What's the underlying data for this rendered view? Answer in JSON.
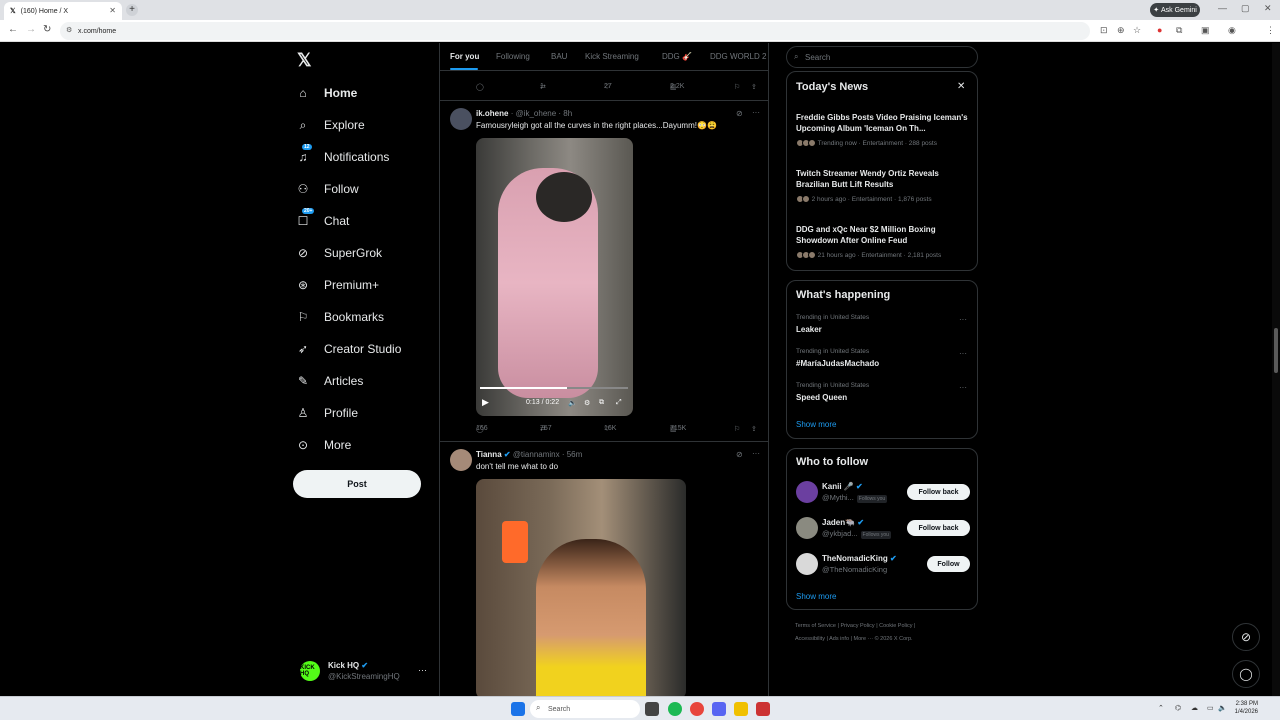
{
  "browser": {
    "tab_title": "(160) Home / X",
    "url": "x.com/home",
    "gemini_label": "Ask Gemini"
  },
  "sidebar": {
    "items": [
      {
        "label": "Home",
        "icon": "home-icon"
      },
      {
        "label": "Explore",
        "icon": "search-icon"
      },
      {
        "label": "Notifications",
        "icon": "bell-icon",
        "badge": "12"
      },
      {
        "label": "Follow",
        "icon": "person-plus-icon"
      },
      {
        "label": "Chat",
        "icon": "chat-icon",
        "badge": "20+"
      },
      {
        "label": "SuperGrok",
        "icon": "grok-icon"
      },
      {
        "label": "Premium+",
        "icon": "x-check-icon"
      },
      {
        "label": "Bookmarks",
        "icon": "bookmark-icon"
      },
      {
        "label": "Creator Studio",
        "icon": "rocket-icon"
      },
      {
        "label": "Articles",
        "icon": "article-icon"
      },
      {
        "label": "Profile",
        "icon": "person-icon"
      },
      {
        "label": "More",
        "icon": "more-circle-icon"
      }
    ],
    "post_label": "Post",
    "account": {
      "name": "Kick HQ",
      "handle": "@KickStreamingHQ",
      "avatar_text": "KICK HQ"
    }
  },
  "feed": {
    "tabs": [
      "For you",
      "Following",
      "BAU",
      "Kick Streaming",
      "DDG 🎸",
      "DDG WORLD 2"
    ],
    "prev_actions": {
      "replies": "",
      "reposts": "1",
      "likes": "27",
      "views": "2.2K"
    },
    "posts": [
      {
        "name": "ik.ohene",
        "handle": "@ik_ohene",
        "time": "8h",
        "text": "Famousryleigh got all the curves in the right places...Dayumm!😳😩",
        "video_time": "0:13 / 0:22",
        "video_progress": 0.59,
        "replies": "166",
        "reposts": "757",
        "likes": "16K",
        "views": "715K"
      },
      {
        "name": "Tianna",
        "handle": "@tiannaminx",
        "time": "56m",
        "text": "don't tell me what to do"
      }
    ]
  },
  "right": {
    "search_placeholder": "Search",
    "news": {
      "title": "Today's News",
      "items": [
        {
          "title": "Freddie Gibbs Posts Video Praising Iceman's Upcoming Album 'Iceman On Th...",
          "meta": "Trending now · Entertainment · 288 posts"
        },
        {
          "title": "Twitch Streamer Wendy Ortiz Reveals Brazilian Butt Lift Results",
          "meta": "2 hours ago · Entertainment · 1,876 posts"
        },
        {
          "title": "DDG and xQc Near $2 Million Boxing Showdown After Online Feud",
          "meta": "21 hours ago · Entertainment · 2,181 posts"
        }
      ]
    },
    "happening": {
      "title": "What's happening",
      "items": [
        {
          "context": "Trending in United States",
          "name": "Leaker"
        },
        {
          "context": "Trending in United States",
          "name": "#MaríaJudasMachado"
        },
        {
          "context": "Trending in United States",
          "name": "Speed Queen"
        }
      ],
      "show_more": "Show more"
    },
    "who_to_follow": {
      "title": "Who to follow",
      "items": [
        {
          "name": "Kanii 🎤",
          "handle": "@Mythi...",
          "follows_you": "Follows you",
          "button": "Follow back"
        },
        {
          "name": "Jaden🐃",
          "handle": "@ykbjad...",
          "follows_you": "Follows you",
          "button": "Follow back"
        },
        {
          "name": "TheNomadicKing",
          "handle": "@TheNomadicKing",
          "follows_you": "",
          "button": "Follow"
        }
      ],
      "show_more": "Show more"
    },
    "footer_line1": "Terms of Service  |  Privacy Policy  |  Cookie Policy  |",
    "footer_line2": "Accessibility  |  Ads info  |  More ···  © 2026 X Corp."
  },
  "taskbar": {
    "search_label": "Search",
    "time": "2:38 PM",
    "date": "1/4/2026"
  }
}
